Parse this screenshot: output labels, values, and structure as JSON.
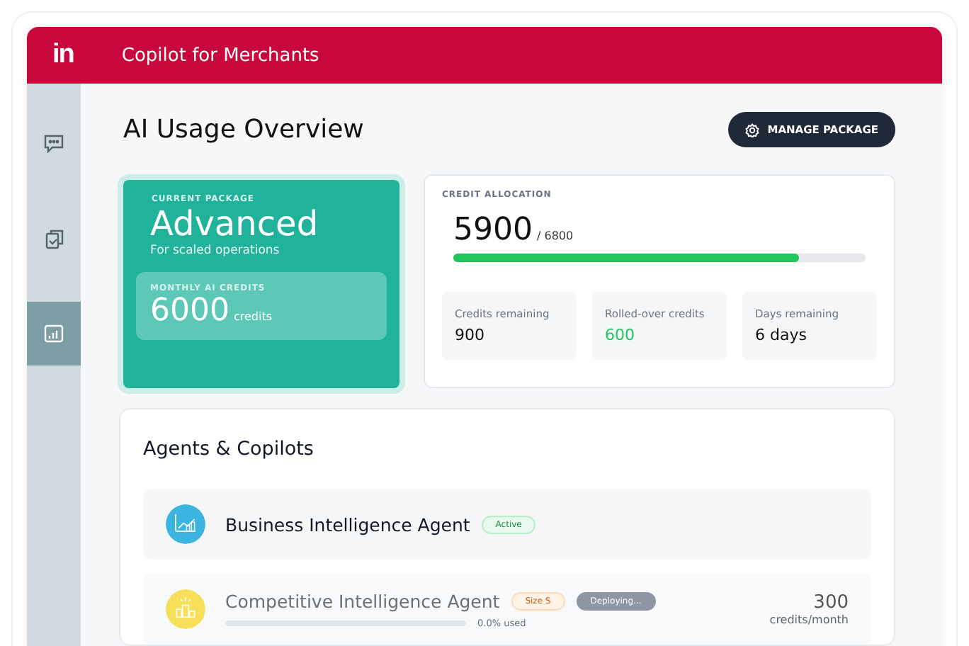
{
  "app": {
    "title": "Copilot for Merchants",
    "logo": "in"
  },
  "sidebar": {
    "items": [
      {
        "selected": false
      },
      {
        "selected": false
      },
      {
        "selected": true
      }
    ]
  },
  "page": {
    "title": "AI Usage Overview",
    "action": "MANAGE PACKAGE"
  },
  "package": {
    "label": "CURRENT PACKAGE",
    "name": "Advanced",
    "subtitle": "For scaled operations",
    "credits_label": "MONTHLY AI CREDITS",
    "credits": "6000",
    "credits_unit": "credits"
  },
  "allocation": {
    "label": "CREDIT ALLOCATION",
    "used": "5900",
    "total": "/ 6800",
    "level": 0.84,
    "stats": [
      {
        "label": "Credits remaining",
        "value": "900",
        "highlight": false
      },
      {
        "label": "Rolled-over credits",
        "value": "600",
        "highlight": true
      },
      {
        "label": "Days remaining",
        "value": "6 days",
        "highlight": false
      }
    ]
  },
  "agents": {
    "title": "Agents & Copilots",
    "rows": [
      {
        "name": "Business Intelligence Agent",
        "color": "#3bb4e0",
        "dimmed": false,
        "badges": [
          {
            "text": "Active",
            "kind": "success"
          }
        ]
      },
      {
        "name": "Competitive Intelligence Agent",
        "color": "#f7df5a",
        "dimmed": true,
        "badges": [
          {
            "text": "Size S",
            "kind": "warning"
          },
          {
            "text": "Deploying...",
            "kind": "neutral"
          }
        ],
        "level": 0,
        "usage": "0.0% used",
        "credits": "300",
        "credits_unit": "credits/month"
      }
    ]
  }
}
